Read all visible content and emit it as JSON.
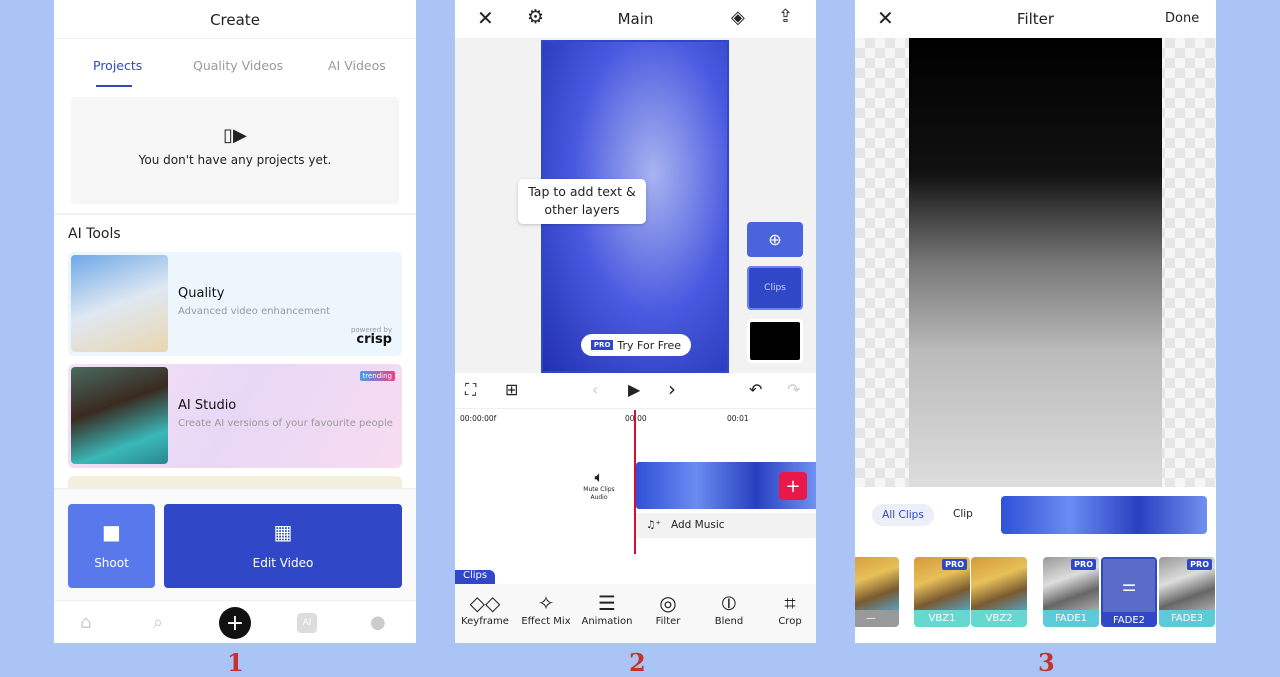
{
  "colors": {
    "background": "#aac4f6",
    "accent": "#3048c8",
    "playhead": "#d0103a",
    "step_numbers": "#c8302c"
  },
  "step_numbers": [
    "1",
    "2",
    "3"
  ],
  "screen1": {
    "title": "Create",
    "tabs": [
      {
        "label": "Projects",
        "active": true
      },
      {
        "label": "Quality Videos"
      },
      {
        "label": "AI Videos"
      }
    ],
    "empty_icon": "video-stack-icon",
    "empty_text": "You don't have any projects yet.",
    "section_title": "AI Tools",
    "tools": [
      {
        "title": "Quality",
        "subtitle": "Advanced video enhancement",
        "powered_by": "powered by",
        "brand": "crisp"
      },
      {
        "title": "AI Studio",
        "subtitle": "Create AI versions of your favourite people",
        "badge": "trending"
      }
    ],
    "shoot_label": "Shoot",
    "edit_label": "Edit Video",
    "nav": [
      {
        "icon": "home-icon"
      },
      {
        "icon": "search-icon"
      },
      {
        "icon": "plus-icon"
      },
      {
        "icon": "ai-icon",
        "label": "AI"
      },
      {
        "icon": "profile-icon"
      }
    ]
  },
  "screen2": {
    "title": "Main",
    "tooltip": "Tap to add text & other layers",
    "pro_badge": "PRO",
    "try_label": "Try For Free",
    "clips_chip": "Clips",
    "time_start": "00:00:00f",
    "time_marks": [
      "00:00",
      "00:01"
    ],
    "mute_label": "Mute Clips Audio",
    "add_music": "Add Music",
    "clips_tab": "Clips",
    "tools": [
      {
        "label": "Keyframe",
        "icon": "keyframe-icon"
      },
      {
        "label": "Effect Mix",
        "icon": "magic-wand-icon"
      },
      {
        "label": "Animation",
        "icon": "animation-icon"
      },
      {
        "label": "Filter",
        "icon": "filter-icon"
      },
      {
        "label": "Blend",
        "icon": "blend-icon"
      },
      {
        "label": "Crop",
        "icon": "crop-icon"
      }
    ]
  },
  "screen3": {
    "title": "Filter",
    "done": "Done",
    "scope": [
      {
        "label": "All Clips",
        "active": true
      },
      {
        "label": "Clip"
      }
    ],
    "filters": [
      {
        "label": "—",
        "style": "none"
      },
      {
        "label": "VBZ1",
        "pro": true
      },
      {
        "label": "VBZ2"
      },
      {
        "label": "FADE1",
        "pro": true
      },
      {
        "label": "FADE2",
        "selected": true
      },
      {
        "label": "FADE3",
        "pro": true
      }
    ],
    "pro_badge": "PRO"
  }
}
